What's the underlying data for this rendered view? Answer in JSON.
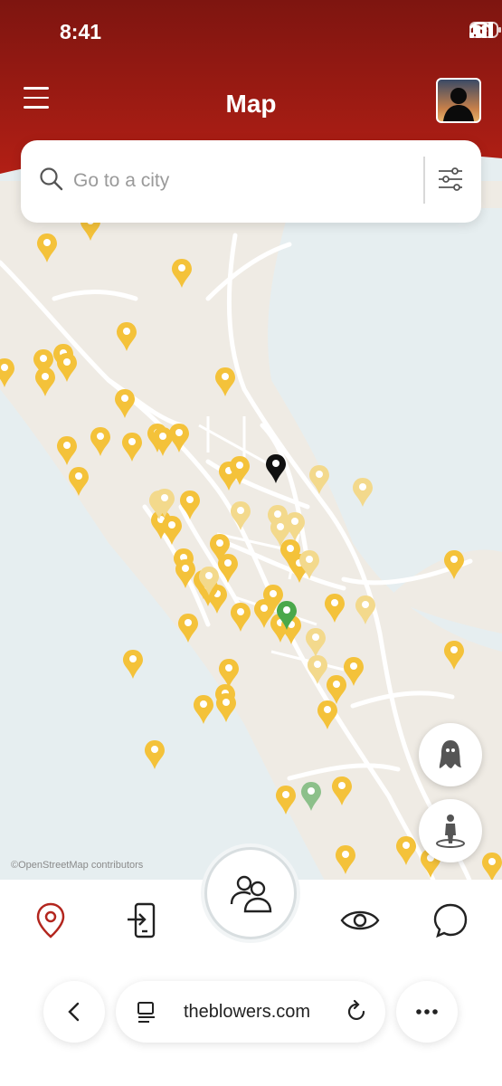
{
  "status_bar": {
    "time": "8:41"
  },
  "header": {
    "title": "Map"
  },
  "search": {
    "placeholder": "Go to a city"
  },
  "map": {
    "attribution": "©OpenStreetMap contributors"
  },
  "bottom_nav": {
    "items": [
      {
        "icon": "map-pin-icon",
        "active": true
      },
      {
        "icon": "phone-login-icon",
        "active": false
      },
      {
        "icon": "people-icon",
        "active": false
      },
      {
        "icon": "eye-icon",
        "active": false
      },
      {
        "icon": "chat-bubble-icon",
        "active": false
      }
    ]
  },
  "browser": {
    "url": "theblowers.com"
  },
  "colors": {
    "brand_red": "#9a1a12",
    "pin_yellow": "#f4c23a",
    "pin_green": "#4aa84a",
    "pin_black": "#111111",
    "water": "#e6eef0",
    "land": "#efebe4"
  }
}
